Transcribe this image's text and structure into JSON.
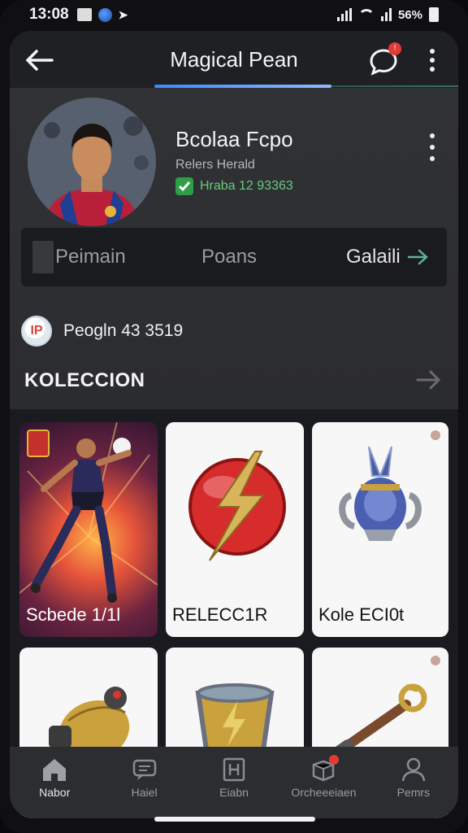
{
  "status_bar": {
    "time": "13:08",
    "battery": "56%"
  },
  "app_bar": {
    "title": "Magical Pean",
    "chat_badge": "!"
  },
  "profile": {
    "name": "Bcolaa Fcpo",
    "subtitle": "Relers Herald",
    "verified_text": "Hraba 12 93363"
  },
  "segments": [
    "Peimain",
    "Poans",
    "Galaili"
  ],
  "points": {
    "coin_label": "IP",
    "text": "Peogln 43 3519"
  },
  "collection": {
    "title": "KOLECCION",
    "cards": [
      {
        "label": "Scbede 1/1l",
        "kind": "player"
      },
      {
        "label": "RELECC1R",
        "kind": "emblem"
      },
      {
        "label": "Kole ECI0t",
        "kind": "vase"
      },
      {
        "label": "",
        "kind": "orb"
      },
      {
        "label": "",
        "kind": "shield"
      },
      {
        "label": "",
        "kind": "wand"
      }
    ]
  },
  "bottom_nav": [
    {
      "label": "Nabor",
      "icon": "home-icon"
    },
    {
      "label": "Haiel",
      "icon": "chat-icon"
    },
    {
      "label": "Eiabn",
      "icon": "grid-icon"
    },
    {
      "label": "Orcheeeiaen",
      "icon": "gift-icon"
    },
    {
      "label": "Pemrs",
      "icon": "person-icon"
    }
  ],
  "colors": {
    "accent": "#3a8bff",
    "verified": "#2e9e47",
    "badge": "#e53935"
  }
}
